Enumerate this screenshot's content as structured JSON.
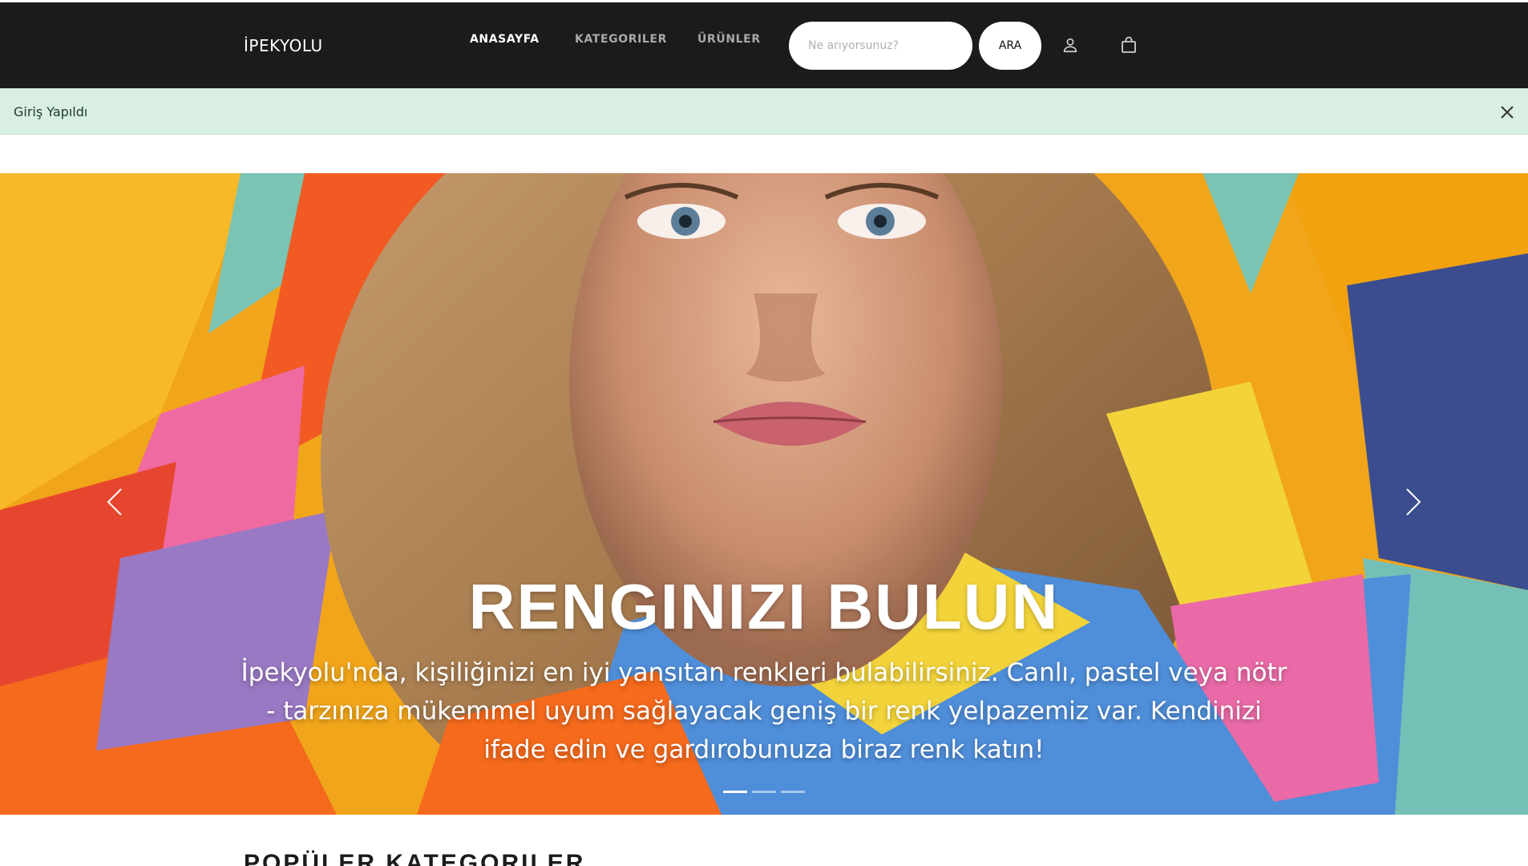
{
  "navbar": {
    "brand": "İPEKYOLU",
    "links": [
      {
        "label": "ANASAYFA",
        "active": true
      },
      {
        "label": "KATEGORILER",
        "active": false
      },
      {
        "label": "ÜRÜNLER",
        "active": false
      }
    ],
    "search_placeholder": "Ne arıyorsunuz?",
    "search_button": "ARA",
    "icons": [
      "user-icon",
      "shopping-bag-icon"
    ]
  },
  "alert": {
    "message": "Giriş Yapıldı",
    "close_icon": "close-icon"
  },
  "hero": {
    "title": "RENGINIZI BULUN",
    "description": "İpekyolu'nda, kişiliğinizi en iyi yansıtan renkleri bulabilirsiniz. Canlı, pastel veya nötr - tarzınıza mükemmel uyum sağlayacak geniş bir renk yelpazemiz var. Kendinizi ifade edin ve gardırobunuza biraz renk katın!",
    "prev_icon": "chevron-left-icon",
    "next_icon": "chevron-right-icon",
    "slide_count": 3,
    "active_slide": 1
  },
  "section": {
    "title": "POPÜLER KATEGORILER"
  },
  "colors": {
    "navbar_bg": "#1b1b1b",
    "alert_bg": "#d8efe2",
    "hero_yellow": "#f0a81a"
  }
}
